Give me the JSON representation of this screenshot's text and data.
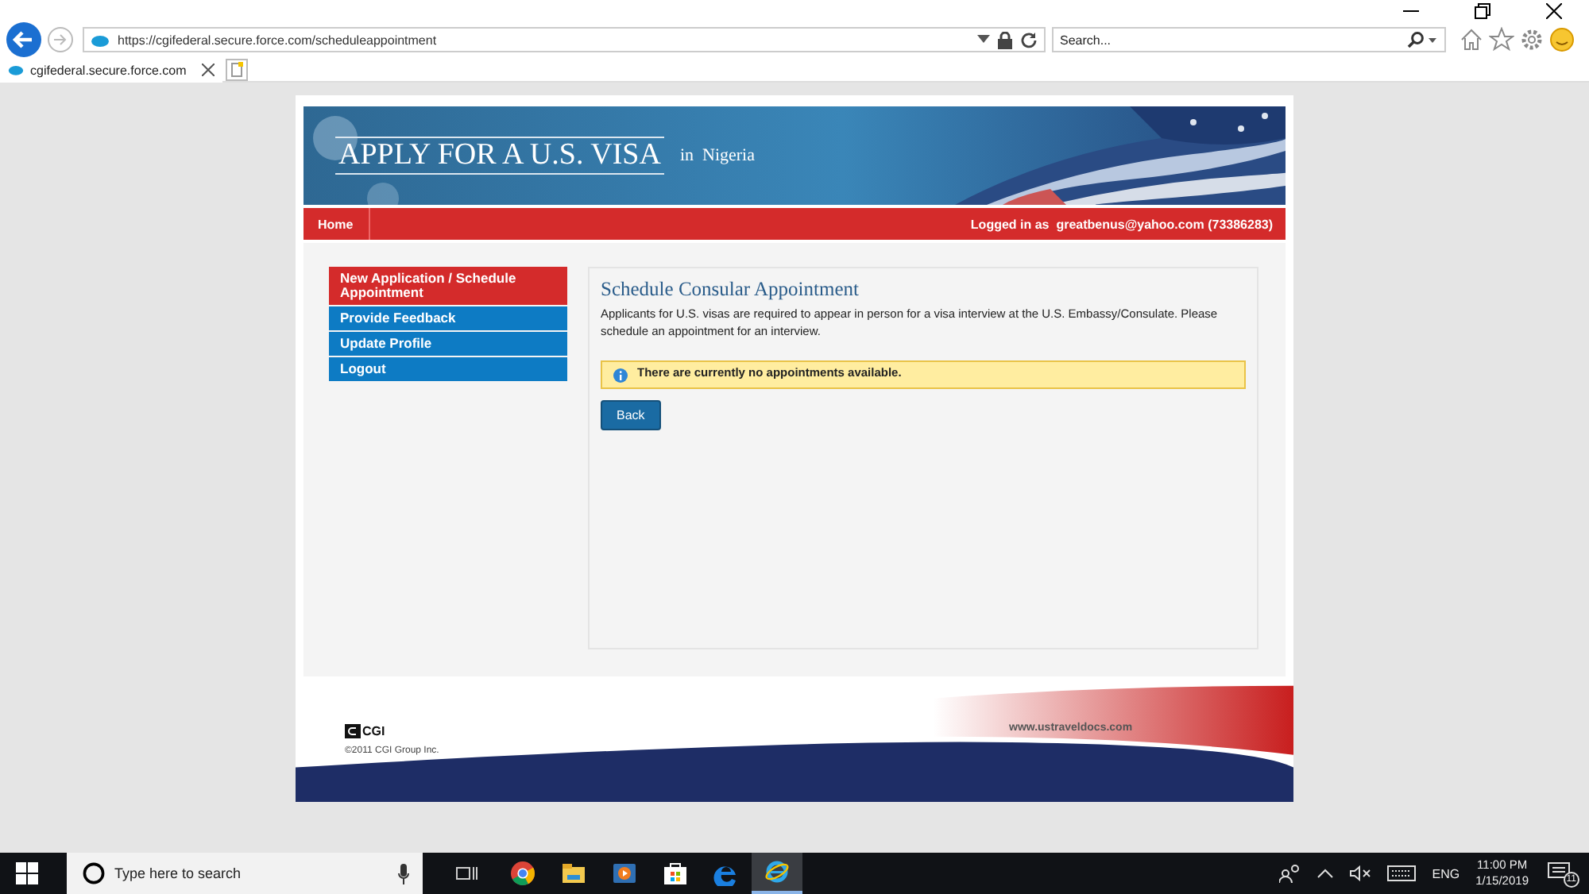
{
  "browser": {
    "url": "https://cgifederal.secure.force.com/scheduleappointment",
    "search_placeholder": "Search...",
    "tab_title": "cgifederal.secure.force.com"
  },
  "banner": {
    "title": "APPLY FOR A U.S. VISA",
    "subtitle": "in  Nigeria"
  },
  "nav": {
    "home": "Home",
    "logged_in": "Logged in as  greatbenus@yahoo.com (73386283)"
  },
  "sidebar": {
    "items": [
      {
        "label": "New Application / Schedule Appointment",
        "selected": true
      },
      {
        "label": "Provide Feedback",
        "selected": false
      },
      {
        "label": "Update Profile",
        "selected": false
      },
      {
        "label": "Logout",
        "selected": false
      }
    ]
  },
  "panel": {
    "heading": "Schedule Consular Appointment",
    "text": "Applicants for U.S. visas are required to appear in person for a visa interview at the U.S. Embassy/Consulate. Please schedule an appointment for an interview.",
    "alert": "There are currently no appointments available.",
    "button": "Back"
  },
  "footer": {
    "logo_text": "CGI",
    "website": "www.ustraveldocs.com",
    "copyright": "©2011 CGI Group Inc."
  },
  "taskbar": {
    "search_placeholder": "Type here to search",
    "apps": [
      {
        "kind": "chrome",
        "selected": false
      },
      {
        "kind": "explorer",
        "selected": false
      },
      {
        "kind": "media",
        "selected": false
      },
      {
        "kind": "store",
        "selected": false
      },
      {
        "kind": "edge",
        "selected": false
      },
      {
        "kind": "ie",
        "selected": true
      }
    ],
    "language": "ENG",
    "time": "11:00 PM",
    "date": "1/15/2019",
    "notification_count": "11"
  }
}
